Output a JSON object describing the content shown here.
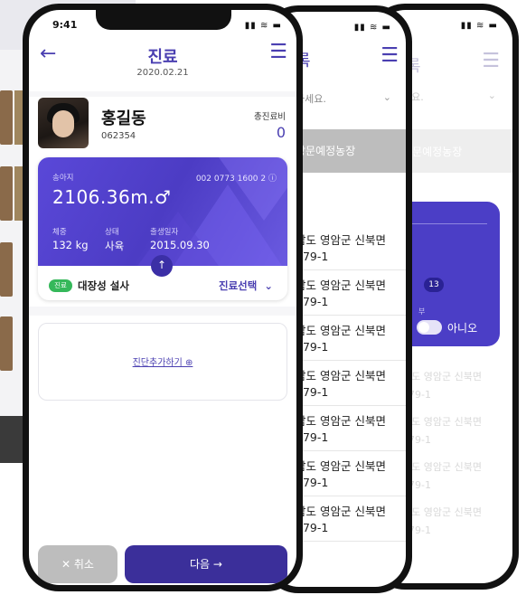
{
  "status": {
    "time": "9:41",
    "icons": "▮▮ ≋ ▬"
  },
  "phone3": {
    "title": "록",
    "placeholder": "세요.",
    "chevron": "⌄",
    "band_text": "방문예정농장",
    "badge": "13",
    "label_small": "부",
    "toggle_no": "아니오",
    "faded_rows": [
      {
        "l1": "남도 영암군 신북면",
        "l2": "979-1"
      },
      {
        "l1": "남도 영암군 신북면",
        "l2": "979-1"
      },
      {
        "l1": "남도 영암군 신북면",
        "l2": "979-1"
      },
      {
        "l1": "남도 영암군 신북면",
        "l2": "979-1"
      }
    ]
  },
  "phone2": {
    "title": "록",
    "placeholder": "하세요.",
    "chevron": "⌄",
    "band_text": "방문예정농장",
    "rows": [
      {
        "l1": "남도 영암군 신북면",
        "l2": "979-1"
      },
      {
        "l1": "남도 영암군 신북면",
        "l2": "979-1"
      },
      {
        "l1": "남도 영암군 신북면",
        "l2": "979-1"
      },
      {
        "l1": "남도 영암군 신북면",
        "l2": "979-1"
      },
      {
        "l1": "남도 영암군 신북면",
        "l2": "979-1"
      },
      {
        "l1": "남도 영암군 신북면",
        "l2": "979-1"
      },
      {
        "l1": "남도 영암군 신북면",
        "l2": "979-1"
      }
    ]
  },
  "main": {
    "back_icon": "←",
    "menu_icon": "☰",
    "title": "진료",
    "date": "2020.02.21",
    "vet_name": "홍길동",
    "vet_code": "062354",
    "fee_label": "총진료비",
    "fee_value": "0",
    "cow": {
      "type_label": "송아지",
      "id_number": "002 0773 1600 2 ⓘ",
      "weight_display": "2106.36m.♂",
      "weight_label": "체중",
      "weight_value": "132 kg",
      "state_label": "상태",
      "state_value": "사육",
      "birth_label": "출생일자",
      "birth_value": "2015.09.30",
      "up_icon": "↑",
      "tag": "진료",
      "disease": "대장성 설사",
      "select_label": "진료선택",
      "select_chevron": "⌄"
    },
    "add_diagnosis": "진단추가하기 ⊕",
    "cancel": "✕ 취소",
    "next": "다음 →"
  }
}
